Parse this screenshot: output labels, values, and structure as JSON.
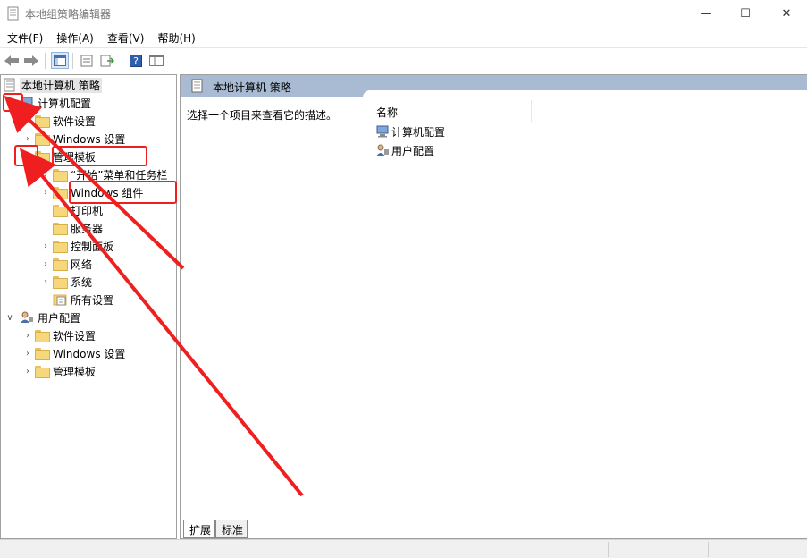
{
  "window": {
    "title": "本地组策略编辑器",
    "minimize_glyph": "—",
    "maximize_glyph": "☐",
    "close_glyph": "✕"
  },
  "menu": [
    "文件(F)",
    "操作(A)",
    "查看(V)",
    "帮助(H)"
  ],
  "toolbar": {
    "back_glyph": "◀",
    "forward_glyph": "▶",
    "help_glyph": "?"
  },
  "tree": {
    "root": "本地计算机 策略",
    "computer": {
      "label": "计算机配置",
      "software": "软件设置",
      "windows": "Windows 设置",
      "admin": {
        "label": "管理模板",
        "children": [
          "“开始”菜单和任务栏",
          "Windows 组件",
          "打印机",
          "服务器",
          "控制面板",
          "网络",
          "系统",
          "所有设置"
        ]
      }
    },
    "user": {
      "label": "用户配置",
      "software": "软件设置",
      "windows": "Windows 设置",
      "admin": "管理模板"
    },
    "expanded_glyph": "∨",
    "collapsed_glyph": "›"
  },
  "right": {
    "header": "本地计算机 策略",
    "description": "选择一个项目来查看它的描述。",
    "column_name": "名称",
    "items": [
      "计算机配置",
      "用户配置"
    ]
  },
  "tabs": [
    "扩展",
    "标准"
  ],
  "colors": {
    "header_bg": "#a9bbd2",
    "annotation_red": "#f01f1f",
    "folder_yellow": "#f6d77b"
  }
}
